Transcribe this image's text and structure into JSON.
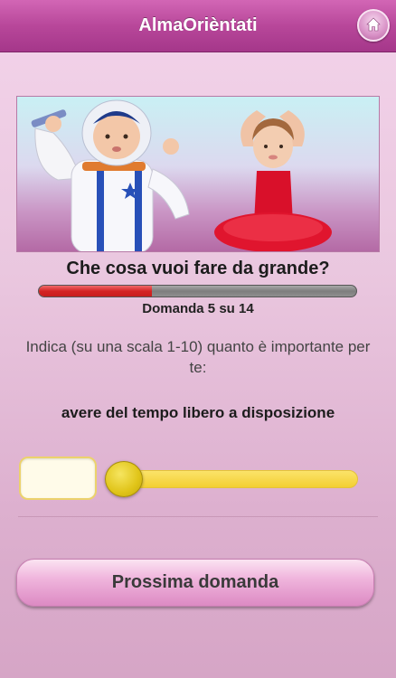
{
  "app": {
    "title": "AlmaOrièntati",
    "home_icon": "home-icon"
  },
  "quiz": {
    "title": "Che cosa vuoi fare da grande?",
    "progress_fraction": 0.357,
    "counter_text": "Domanda 5 su 14",
    "instruction": "Indica (su una scala 1-10) quanto è importante per te:",
    "statement": "avere del tempo libero a disposizione",
    "slider_value": "",
    "slider_level_fraction": 0.0,
    "next_label": "Prossima domanda"
  },
  "colors": {
    "navbar": "#b8479a",
    "progress_fill": "#d42424",
    "slider_track": "#f3cf32",
    "button": "#f0b6dd"
  }
}
